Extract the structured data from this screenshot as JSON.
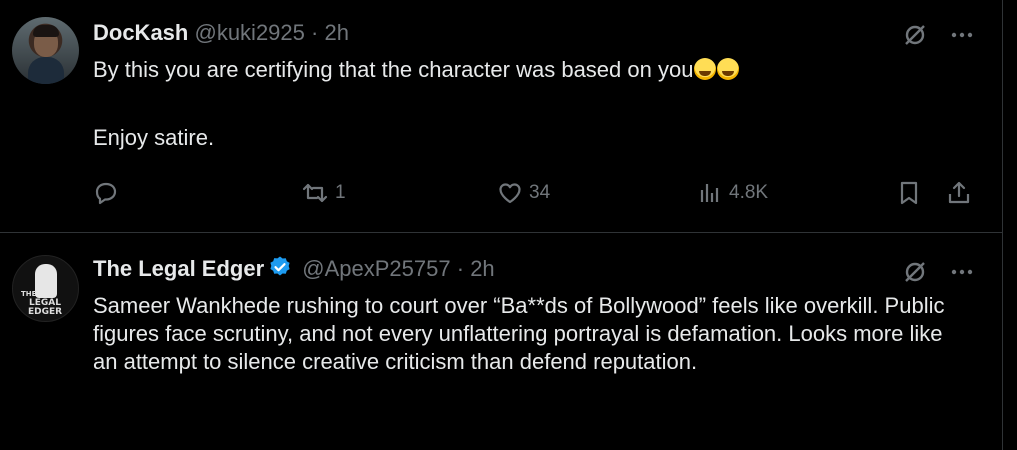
{
  "tweets": [
    {
      "name": "DocKash",
      "handle": "@kuki2925",
      "separator": "·",
      "time": "2h",
      "text": "By this you are certifying that the character was based on you",
      "text_line2": "Enjoy satire.",
      "emojis": [
        "grinning-sweat-emoji",
        "tears-of-joy-emoji"
      ],
      "stats": {
        "replies": "",
        "reposts": "1",
        "likes": "34",
        "views": "4.8K"
      }
    },
    {
      "name": "The Legal Edger",
      "verified": true,
      "handle": "@ApexP25757",
      "separator": "·",
      "time": "2h",
      "avatar_text_top": "THE",
      "avatar_text_mid": "LEGAL",
      "avatar_text_bottom": "EDGER",
      "text": "Sameer Wankhede rushing to court over “Ba**ds of Bollywood” feels like overkill. Public figures face scrutiny, and not every unflattering portrayal is defamation. Looks more like an attempt to silence creative criticism than defend reputation."
    }
  ],
  "colors": {
    "background": "#000000",
    "text": "#e7e9ea",
    "muted": "#71767b",
    "border": "#2f3336",
    "verified": "#1d9bf0"
  }
}
